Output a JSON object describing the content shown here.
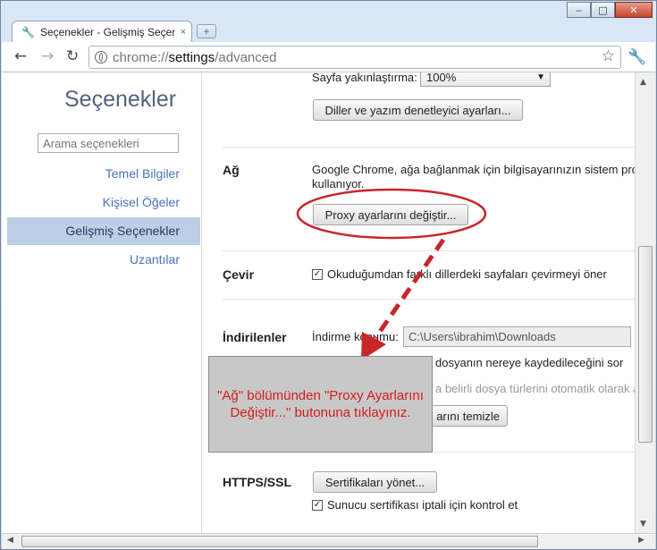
{
  "window": {
    "tab_title": "Seçenekler - Gelişmiş Seçen",
    "tab_close": "×",
    "new_tab": "+",
    "minimize": "‒",
    "maximize": "□",
    "close": "✕"
  },
  "toolbar": {
    "back": "←",
    "forward": "→",
    "reload": "↻",
    "url_scheme": "chrome://",
    "url_host": "settings",
    "url_path": "/advanced",
    "star": "☆",
    "wrench": "🔧"
  },
  "sidebar": {
    "title": "Seçenekler",
    "search_placeholder": "Arama seçenekleri",
    "items": [
      {
        "label": "Temel Bilgiler"
      },
      {
        "label": "Kişisel Öğeler"
      },
      {
        "label": "Gelişmiş Seçenekler",
        "selected": true
      },
      {
        "label": "Uzantılar"
      }
    ]
  },
  "settings": {
    "zoom_label": "Sayfa yakınlaştırma:",
    "zoom_value": "100%",
    "languages_button": "Diller ve yazım denetleyici ayarları...",
    "network": {
      "label": "Ağ",
      "description_line1": "Google Chrome, ağa bağlanmak için bilgisayarınızın sistem pro",
      "description_line2": "kullanıyor.",
      "proxy_button": "Proxy ayarlarını değiştir..."
    },
    "translate": {
      "label": "Çevir",
      "checkbox_label": "Okuduğumdan farklı dillerdeki sayfaları çevirmeyi öner",
      "checked": true
    },
    "downloads": {
      "label": "İndirilenler",
      "location_label": "İndirme konumu:",
      "location_value": "C:\\Users\\ibrahim\\Downloads",
      "ask_text": "dosyanın nereye kaydedileceğini sor",
      "auto_open_text": "a belirli dosya türlerini otomatik olarak a",
      "clear_button_text": "arını temizle"
    },
    "https": {
      "label": "HTTPS/SSL",
      "certificates_button": "Sertifikaları yönet...",
      "revocation_checkbox": "Sunucu sertifikası iptali için kontrol et",
      "checked": true
    }
  },
  "annotation": {
    "callout_text": "\"Ağ\" bölümünden \"Proxy Ayarlarını Değiştir...\" butonuna tıklayınız.",
    "color": "#c8262a"
  },
  "colors": {
    "accent": "#4972b5",
    "selected_bg": "#bccfe6",
    "annotation_red": "#c8262a"
  }
}
